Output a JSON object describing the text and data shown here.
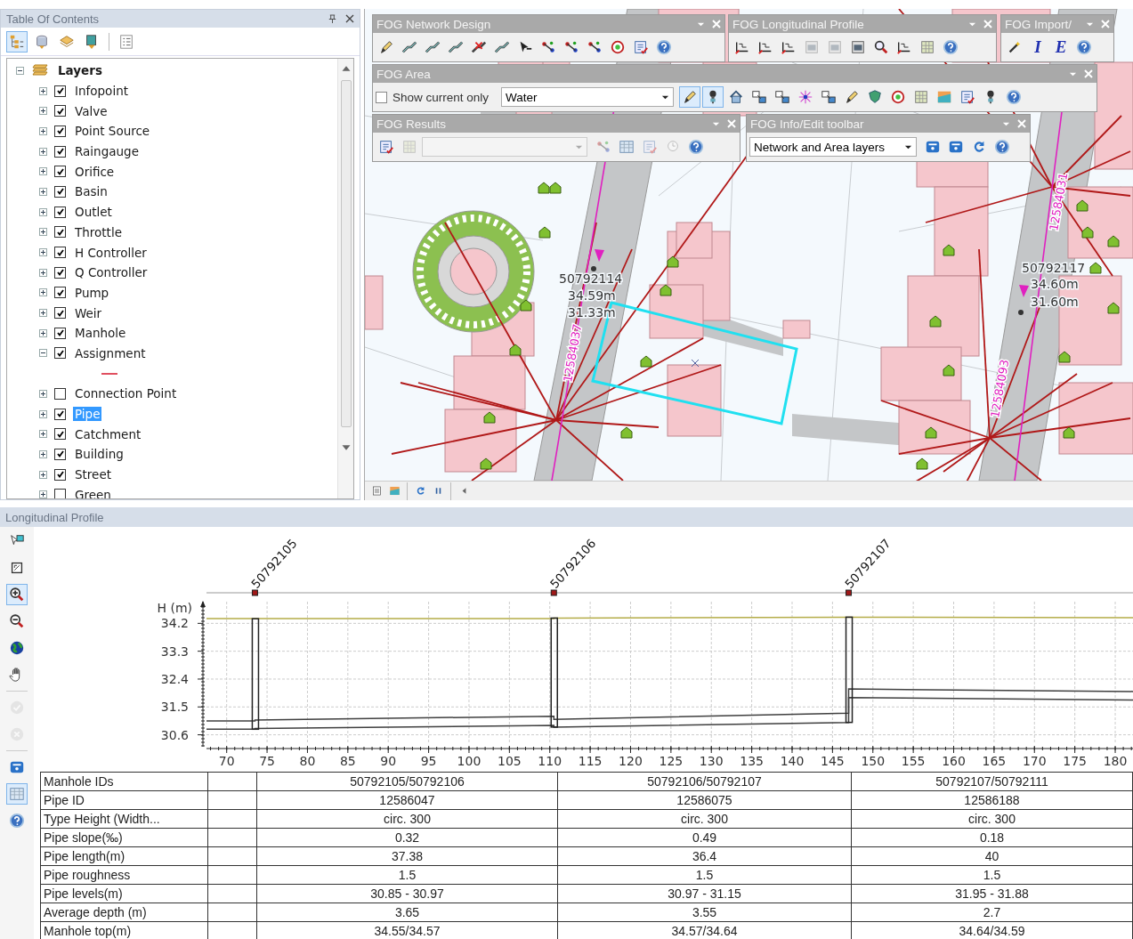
{
  "toc": {
    "title": "Table Of Contents",
    "tools": [
      {
        "kind": "order",
        "selected": true
      },
      {
        "kind": "source",
        "selected": false
      },
      {
        "kind": "visibility",
        "selected": false
      },
      {
        "kind": "selection",
        "selected": false
      },
      {
        "kind": "options",
        "selected": false
      }
    ],
    "tree": [
      {
        "label": "Layers",
        "expanded": true,
        "children": [
          {
            "label": "Infopoint",
            "checked": true,
            "expanded": false,
            "selected": false
          },
          {
            "label": "Valve",
            "checked": true,
            "expanded": false,
            "selected": false
          },
          {
            "label": "Point Source",
            "checked": true,
            "expanded": false,
            "selected": false
          },
          {
            "label": "Raingauge",
            "checked": true,
            "expanded": false,
            "selected": false
          },
          {
            "label": "Orifice",
            "checked": true,
            "expanded": false,
            "selected": false
          },
          {
            "label": "Basin",
            "checked": true,
            "expanded": false,
            "selected": false
          },
          {
            "label": "Outlet",
            "checked": true,
            "expanded": false,
            "selected": false
          },
          {
            "label": "Throttle",
            "checked": true,
            "expanded": false,
            "selected": false
          },
          {
            "label": "H Controller",
            "checked": true,
            "expanded": false,
            "selected": false
          },
          {
            "label": "Q Controller",
            "checked": true,
            "expanded": false,
            "selected": false
          },
          {
            "label": "Pump",
            "checked": true,
            "expanded": false,
            "selected": false
          },
          {
            "label": "Weir",
            "checked": true,
            "expanded": false,
            "selected": false
          },
          {
            "label": "Manhole",
            "checked": true,
            "expanded": false,
            "selected": false
          },
          {
            "label": "Assignment",
            "checked": true,
            "expanded": true,
            "selected": false,
            "children": [
              {
                "kind": "legend-line"
              }
            ]
          },
          {
            "label": "Connection Point",
            "checked": false,
            "expanded": false,
            "selected": false
          },
          {
            "label": "Pipe",
            "checked": true,
            "expanded": false,
            "selected": true
          },
          {
            "label": "Catchment",
            "checked": true,
            "expanded": false,
            "selected": false
          },
          {
            "label": "Building",
            "checked": true,
            "expanded": false,
            "selected": false
          },
          {
            "label": "Street",
            "checked": true,
            "expanded": false,
            "selected": false
          },
          {
            "label": "Green",
            "checked": false,
            "expanded": false,
            "selected": false
          }
        ]
      }
    ]
  },
  "map": {
    "labels": [
      {
        "kind": "node",
        "text": "50792114"
      },
      {
        "kind": "node",
        "text": "34.59m"
      },
      {
        "kind": "node",
        "text": "31.33m"
      },
      {
        "kind": "node",
        "text": "50792117"
      },
      {
        "kind": "node",
        "text": "34.60m"
      },
      {
        "kind": "node",
        "text": "31.60m"
      },
      {
        "kind": "pipe",
        "text": "12584037"
      },
      {
        "kind": "pipe",
        "text": "12584093"
      },
      {
        "kind": "pipe",
        "text": "12584031"
      }
    ]
  },
  "toolbars": [
    {
      "title": "FOG Network Design",
      "items": [
        {
          "kind": "pen"
        },
        {
          "kind": "pipe"
        },
        {
          "kind": "pipe"
        },
        {
          "kind": "pipe"
        },
        {
          "kind": "delete"
        },
        {
          "kind": "pipe"
        },
        {
          "kind": "cursor"
        },
        {
          "kind": "node"
        },
        {
          "kind": "node"
        },
        {
          "kind": "node"
        },
        {
          "kind": "target"
        },
        {
          "kind": "form"
        },
        {
          "kind": "help"
        }
      ]
    },
    {
      "title": "FOG Longitudinal Profile",
      "items": [
        {
          "kind": "profile",
          "disabled": false
        },
        {
          "kind": "profile",
          "disabled": false
        },
        {
          "kind": "profile",
          "disabled": false
        },
        {
          "kind": "window",
          "disabled": true
        },
        {
          "kind": "window",
          "disabled": true
        },
        {
          "kind": "window",
          "disabled": false
        },
        {
          "kind": "zoom",
          "disabled": false
        },
        {
          "kind": "profile",
          "disabled": false
        },
        {
          "kind": "grid",
          "disabled": false
        },
        {
          "kind": "help",
          "disabled": false
        }
      ]
    },
    {
      "title": "FOG Import/",
      "items": [
        {
          "kind": "wand"
        },
        {
          "kind": "letter",
          "label": "I"
        },
        {
          "kind": "letter",
          "label": "E"
        },
        {
          "kind": "help"
        }
      ]
    },
    {
      "title": "FOG Area",
      "items": [
        {
          "kind": "checkbox",
          "label": "Show current only",
          "checked": false
        },
        {
          "kind": "dropdown",
          "value": "Water"
        },
        {
          "kind": "pen",
          "selected": true
        },
        {
          "kind": "pin",
          "selected": true
        },
        {
          "kind": "home",
          "selected": false
        },
        {
          "kind": "link",
          "selected": false
        },
        {
          "kind": "link",
          "selected": false
        },
        {
          "kind": "spark",
          "selected": false
        },
        {
          "kind": "link",
          "selected": false
        },
        {
          "kind": "pen",
          "selected": false
        },
        {
          "kind": "shield",
          "selected": false
        },
        {
          "kind": "target",
          "selected": false
        },
        {
          "kind": "grid",
          "selected": false
        },
        {
          "kind": "map",
          "selected": false
        },
        {
          "kind": "form",
          "selected": false
        },
        {
          "kind": "pin",
          "selected": false
        },
        {
          "kind": "help",
          "selected": false
        }
      ]
    },
    {
      "title": "FOG Results",
      "items": [
        {
          "kind": "form",
          "disabled": false
        },
        {
          "kind": "grid",
          "disabled": true
        },
        {
          "kind": "dropdown",
          "disabled": true
        },
        {
          "kind": "node",
          "disabled": true
        },
        {
          "kind": "table",
          "disabled": false
        },
        {
          "kind": "form",
          "disabled": true
        },
        {
          "kind": "clock",
          "disabled": true
        },
        {
          "kind": "help",
          "disabled": false
        }
      ]
    },
    {
      "title": "FOG Info/Edit toolbar",
      "items": [
        {
          "kind": "dropdown",
          "value": "Network and Area layers"
        },
        {
          "kind": "info"
        },
        {
          "kind": "info"
        },
        {
          "kind": "refresh"
        },
        {
          "kind": "help"
        }
      ]
    }
  ],
  "profile": {
    "title": "Longitudinal Profile",
    "tools": [
      {
        "kind": "pointer",
        "selected": false,
        "disabled": false
      },
      {
        "kind": "extent",
        "selected": false,
        "disabled": false
      },
      {
        "kind": "zoomin",
        "selected": true,
        "disabled": false
      },
      {
        "kind": "zoomout",
        "selected": false,
        "disabled": false
      },
      {
        "kind": "globe",
        "selected": false,
        "disabled": false
      },
      {
        "kind": "hand",
        "selected": false,
        "disabled": false
      },
      {
        "kind": "check",
        "selected": false,
        "disabled": true
      },
      {
        "kind": "reject",
        "selected": false,
        "disabled": true
      },
      {
        "kind": "info",
        "selected": false,
        "disabled": false
      },
      {
        "kind": "table",
        "selected": true,
        "disabled": false
      },
      {
        "kind": "help",
        "selected": false,
        "disabled": false
      }
    ],
    "chart_data": {
      "type": "line",
      "ylabel": "H (m)",
      "x": [
        67.5,
        73.5,
        73.5,
        110.5,
        110.5,
        147,
        147,
        182.2
      ],
      "series": [
        {
          "color": "#b5ad4a",
          "values": [
            34.35,
            34.35,
            34.35,
            34.35,
            34.37,
            34.4,
            34.4,
            34.38
          ]
        },
        {
          "color": "#404040",
          "values": [
            31.05,
            31.05,
            31.08,
            31.2,
            31.1,
            31.3,
            32.08,
            32.0
          ]
        },
        {
          "color": "#404040",
          "values": [
            30.78,
            30.78,
            30.8,
            30.9,
            30.85,
            31.0,
            31.8,
            31.72
          ]
        }
      ],
      "xlim": [
        67.5,
        182.2
      ],
      "ylim": [
        30.3,
        34.9
      ],
      "grid": true,
      "xticks": [
        70,
        75,
        80,
        85,
        90,
        95,
        100,
        105,
        110,
        115,
        120,
        125,
        130,
        135,
        140,
        145,
        150,
        155,
        160,
        165,
        170,
        175,
        180
      ],
      "yticks": [
        30.6,
        31.5,
        32.4,
        33.3,
        34.2
      ]
    },
    "manholes": [
      {
        "label": "50792105"
      },
      {
        "label": "50792106"
      },
      {
        "label": "50792107"
      }
    ],
    "table": {
      "rows": [
        {
          "label": "Manhole IDs",
          "cells": [
            "50792105/50792106",
            "50792106/50792107",
            "50792107/50792111"
          ]
        },
        {
          "label": "Pipe ID",
          "cells": [
            "12586047",
            "12586075",
            "12586188"
          ]
        },
        {
          "label": "Type Height (Width...",
          "cells": [
            "circ. 300",
            "circ. 300",
            "circ. 300"
          ]
        },
        {
          "label": "Pipe slope(‰)",
          "cells": [
            "0.32",
            "0.49",
            "0.18"
          ]
        },
        {
          "label": "Pipe length(m)",
          "cells": [
            "37.38",
            "36.4",
            "40"
          ]
        },
        {
          "label": "Pipe roughness",
          "cells": [
            "1.5",
            "1.5",
            "1.5"
          ]
        },
        {
          "label": "Pipe levels(m)",
          "cells": [
            "30.85 - 30.97",
            "30.97 - 31.15",
            "31.95 - 31.88"
          ]
        },
        {
          "label": "Average depth (m)",
          "cells": [
            "3.65",
            "3.55",
            "2.7"
          ]
        },
        {
          "label": "Manhole top(m)",
          "cells": [
            "34.55/34.57",
            "34.57/34.64",
            "34.64/34.59"
          ]
        }
      ]
    }
  }
}
